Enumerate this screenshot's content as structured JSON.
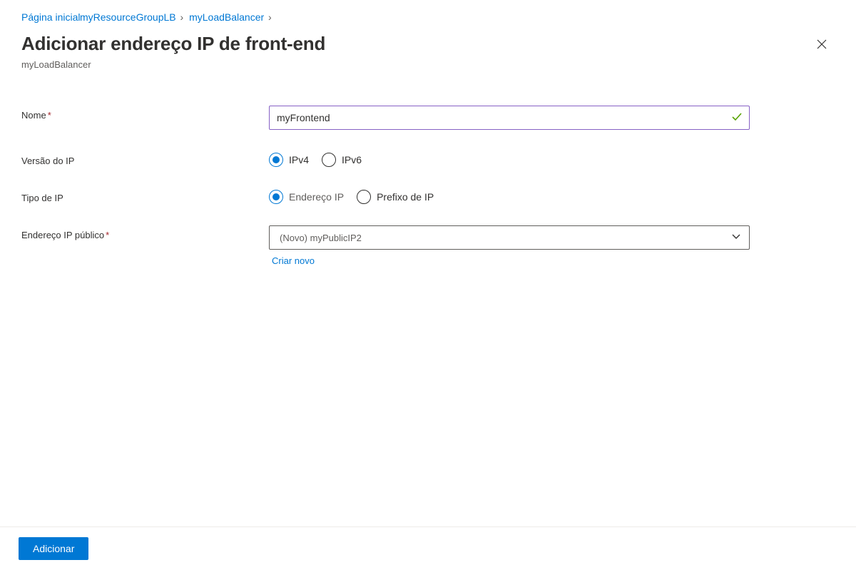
{
  "breadcrumb": {
    "item1": "Página inicial",
    "item2": "myResourceGroupLB",
    "item3": "myLoadBalancer"
  },
  "header": {
    "title": "Adicionar endereço IP de front-end",
    "subtitle": "myLoadBalancer"
  },
  "form": {
    "name": {
      "label": "Nome",
      "value": "myFrontend"
    },
    "ip_version": {
      "label": "Versão do IP",
      "option1": "IPv4",
      "option2": "IPv6",
      "selected": "IPv4"
    },
    "ip_type": {
      "label": "Tipo de IP",
      "option1": "Endereço IP",
      "option2": "Prefixo de IP",
      "selected": "Endereço IP"
    },
    "public_ip": {
      "label": "Endereço IP público",
      "value": "(Novo) myPublicIP2",
      "create_new": "Criar novo"
    }
  },
  "footer": {
    "add_button": "Adicionar"
  }
}
